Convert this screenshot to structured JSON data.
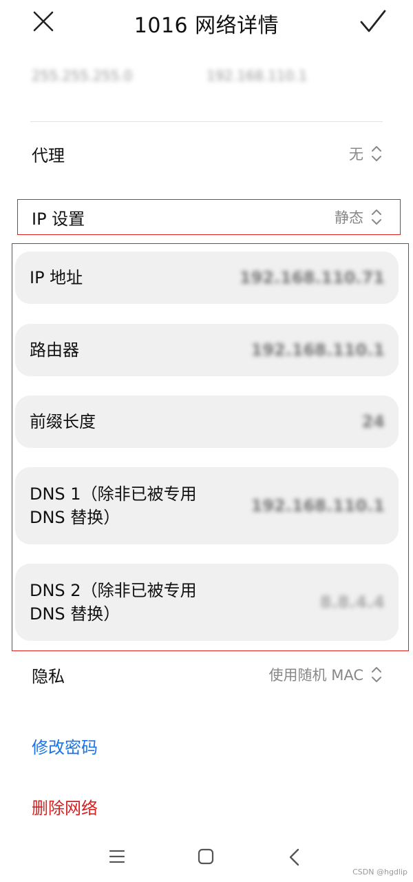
{
  "header": {
    "title": "1016 网络详情"
  },
  "blurred_top": {
    "subnet": "255.255.255.0",
    "gateway": "192.168.110.1"
  },
  "proxy": {
    "label": "代理",
    "value": "无"
  },
  "ip_settings": {
    "label": "IP 设置",
    "value": "静态"
  },
  "static_fields": [
    {
      "label": "IP 地址",
      "value": "192.168.110.71"
    },
    {
      "label": "路由器",
      "value": "192.168.110.1"
    },
    {
      "label": "前缀长度",
      "value": "24"
    },
    {
      "label": "DNS 1（除非已被专用\nDNS 替换）",
      "value": "192.168.110.1"
    },
    {
      "label": "DNS 2（除非已被专用\nDNS 替换）",
      "value": "8.8.4.4"
    }
  ],
  "privacy": {
    "label": "隐私",
    "value": "使用随机 MAC"
  },
  "actions": {
    "modify_password": "修改密码",
    "delete_network": "删除网络"
  },
  "colors": {
    "link_blue": "#1a73e8",
    "delete_red": "#d82020",
    "highlight_red": "#e02020",
    "card_bg": "#f0f0f0"
  },
  "watermark": "CSDN @hgdlip"
}
